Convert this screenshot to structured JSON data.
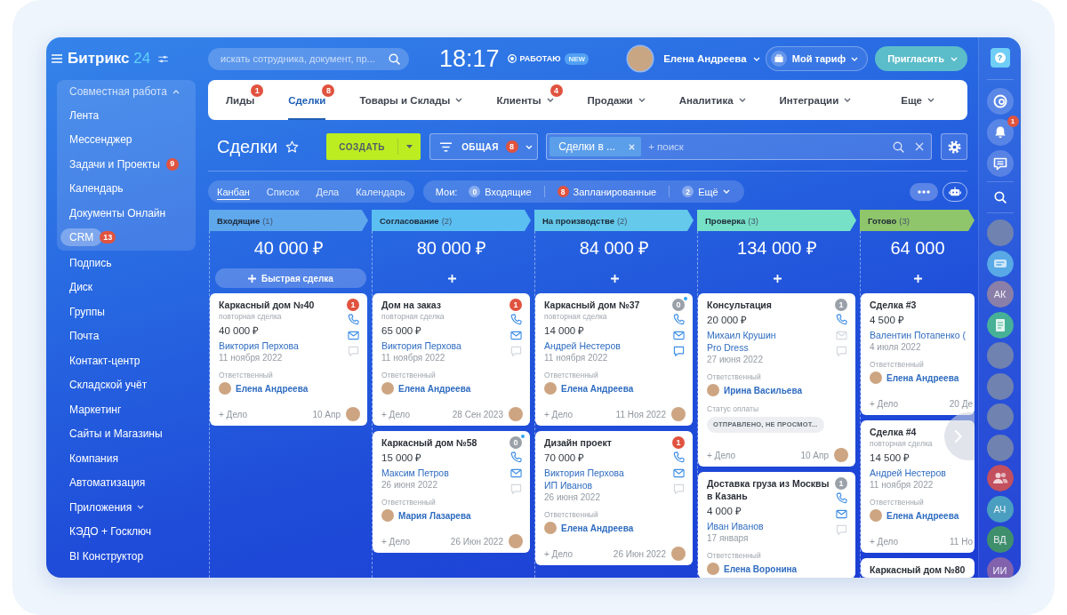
{
  "sidebar": {
    "logo": {
      "name": "Битрикс",
      "number": "24"
    },
    "items": [
      {
        "kind": "group",
        "label": "Совместная работа",
        "expanded": true,
        "children": [
          {
            "label": "Лента",
            "selected": false
          },
          {
            "label": "Мессенджер",
            "selected": false
          },
          {
            "label": "Задачи и Проекты",
            "selected": false,
            "badge": "9"
          },
          {
            "label": "Календарь",
            "selected": false
          },
          {
            "label": "Документы Онлайн",
            "selected": false
          },
          {
            "label": "CRM",
            "selected": true,
            "badge": "13"
          }
        ]
      },
      {
        "kind": "link",
        "label": "Подпись",
        "selected": false
      },
      {
        "kind": "link",
        "label": "Диск",
        "selected": false
      },
      {
        "kind": "link",
        "label": "Группы",
        "selected": false
      },
      {
        "kind": "link",
        "label": "Почта",
        "selected": false
      },
      {
        "kind": "link",
        "label": "Контакт-центр",
        "selected": false
      },
      {
        "kind": "link",
        "label": "Складской учёт",
        "selected": false
      },
      {
        "kind": "link",
        "label": "Маркетинг",
        "selected": false
      },
      {
        "kind": "link",
        "label": "Сайты и Магазины",
        "selected": false
      },
      {
        "kind": "link",
        "label": "Компания",
        "selected": false
      },
      {
        "kind": "link",
        "label": "Автоматизация",
        "selected": false
      },
      {
        "kind": "group",
        "label": "Приложения",
        "expanded": false
      },
      {
        "kind": "link",
        "label": "КЭДО + Госключ",
        "selected": false
      },
      {
        "kind": "link",
        "label": "BI Конструктор",
        "selected": false
      }
    ]
  },
  "header": {
    "search": {
      "placeholder": "искать сотрудника, документ, пр..."
    },
    "clock": "18:17",
    "work_status": {
      "label": "РАБОТАЮ",
      "badge": "NEW"
    },
    "user": {
      "name": "Елена Андреева"
    },
    "tariff_button": {
      "label": "Мой тариф"
    },
    "invite_button": {
      "label": "Пригласить"
    }
  },
  "nav_tabs": [
    {
      "label": "Лиды",
      "badge": "1",
      "dropdown": false,
      "selected": false
    },
    {
      "label": "Сделки",
      "badge": "8",
      "dropdown": false,
      "selected": true
    },
    {
      "label": "Товары и Склады",
      "dropdown": true,
      "selected": false
    },
    {
      "label": "Клиенты",
      "badge": "4",
      "dropdown": true,
      "selected": false
    },
    {
      "label": "Продажи",
      "dropdown": true,
      "selected": false
    },
    {
      "label": "Аналитика",
      "dropdown": true,
      "selected": false
    },
    {
      "label": "Интеграции",
      "dropdown": true,
      "selected": false
    },
    {
      "label": "Еще",
      "dropdown": true,
      "selected": false
    }
  ],
  "toolbar": {
    "title": "Сделки",
    "starred": false,
    "create_button": {
      "label": "СОЗДАТЬ"
    },
    "filter": {
      "label": "ОБЩАЯ",
      "badge": "8"
    },
    "search": {
      "chips": [
        {
          "label": "Сделки в ..."
        }
      ],
      "placeholder": "+ поиск"
    }
  },
  "view_bar": {
    "tabs": [
      {
        "label": "Канбан",
        "selected": true
      },
      {
        "label": "Список",
        "selected": false
      },
      {
        "label": "Дела",
        "selected": false
      },
      {
        "label": "Календарь",
        "selected": false
      }
    ],
    "counters": {
      "label": "Мои:",
      "items": [
        {
          "count": "0",
          "label": "Входящие",
          "alert": false,
          "dropdown": false
        },
        {
          "count": "8",
          "label": "Запланированные",
          "alert": true,
          "dropdown": false
        },
        {
          "count": "2",
          "label": "Ещё",
          "alert": false,
          "dropdown": true
        }
      ]
    }
  },
  "kanban": {
    "columns": [
      {
        "title": "Входящие",
        "count": "(1)",
        "color": "#5fa8ec",
        "total": "40 000 ₽",
        "quick_add": "Быстрая сделка",
        "cards": [
          {
            "title": "Каркасный дом №40",
            "counter": {
              "label": "1",
              "active": true,
              "dot": false
            },
            "subtitle": "повторная сделка",
            "amount": "40 000 ₽",
            "clients": [
              "Виктория Перхова"
            ],
            "date": "11 ноября 2022",
            "responsible": {
              "label": "Ответственный",
              "name": "Елена Андреева"
            },
            "contacts": {
              "phone": true,
              "email": true,
              "chat": false
            },
            "footer": {
              "action": "+ Дело",
              "date": "10 Апр",
              "avatar": true
            }
          }
        ]
      },
      {
        "title": "Согласование",
        "count": "(2)",
        "color": "#5bbff2",
        "total": "80 000 ₽",
        "cards": [
          {
            "title": "Дом на заказ",
            "counter": {
              "label": "1",
              "active": true,
              "dot": false
            },
            "subtitle": "повторная сделка",
            "amount": "65 000 ₽",
            "clients": [
              "Виктория Перхова"
            ],
            "date": "11 ноября 2022",
            "responsible": {
              "label": "Ответственный",
              "name": "Елена Андреева"
            },
            "contacts": {
              "phone": true,
              "email": true,
              "chat": false
            },
            "footer": {
              "action": "+ Дело",
              "date": "28 Сен 2023",
              "avatar": true
            }
          },
          {
            "title": "Каркасный дом №58",
            "counter": {
              "label": "0",
              "active": false,
              "dot": true
            },
            "amount": "15 000 ₽",
            "clients": [
              "Максим Петров"
            ],
            "date": "26 июня 2022",
            "responsible": {
              "label": "Ответственный",
              "name": "Мария Лазарева"
            },
            "contacts": {
              "phone": true,
              "email": true,
              "chat": false
            },
            "footer": {
              "action": "+ Дело",
              "date": "26 Июн 2022",
              "avatar": true
            }
          }
        ]
      },
      {
        "title": "На производстве",
        "count": "(2)",
        "color": "#64c9ea",
        "total": "84 000 ₽",
        "cards": [
          {
            "title": "Каркасный дом №37",
            "counter": {
              "label": "0",
              "active": false,
              "dot": true
            },
            "subtitle": "повторная сделка",
            "amount": "14 000 ₽",
            "clients": [
              "Андрей Нестеров"
            ],
            "date": "11 ноября 2022",
            "responsible": {
              "label": "Ответственный",
              "name": "Елена Андреева"
            },
            "contacts": {
              "phone": true,
              "email": true,
              "chat": true
            },
            "footer": {
              "action": "+ Дело",
              "date": "11 Ноя 2022",
              "avatar": true
            }
          },
          {
            "title": "Дизайн проект",
            "counter": {
              "label": "1",
              "active": true,
              "dot": false
            },
            "amount": "70 000 ₽",
            "clients": [
              "Виктория Перхова",
              "ИП Иванов"
            ],
            "date": "26 июня 2022",
            "responsible": {
              "label": "Ответственный",
              "name": "Елена Андреева"
            },
            "contacts": {
              "phone": true,
              "email": true,
              "chat": false
            },
            "footer": {
              "action": "+ Дело",
              "date": "26 Июн 2022",
              "avatar": true
            }
          }
        ]
      },
      {
        "title": "Проверка",
        "count": "(3)",
        "color": "#76e1c7",
        "total": "134 000 ₽",
        "cards": [
          {
            "title": "Консультация",
            "counter": {
              "label": "1",
              "active": false,
              "dot": false
            },
            "amount": "20 000 ₽",
            "clients": [
              "Михаил Крушин",
              "Pro Dress"
            ],
            "date": "27 июня 2022",
            "responsible": {
              "label": "Ответственный",
              "name": "Ирина Васильева"
            },
            "payment": {
              "label": "Статус оплаты",
              "status": "ОТПРАВЛЕНО, НЕ ПРОСМОТ..."
            },
            "contacts": {
              "phone": true,
              "email": false,
              "chat": false
            },
            "footer": {
              "action": "+ Дело",
              "date": "10 Апр",
              "avatar": true
            }
          },
          {
            "title": "Доставка груза из Москвы в Казань",
            "counter": {
              "label": "1",
              "active": false,
              "dot": false
            },
            "amount": "4 000 ₽",
            "clients": [
              "Иван Иванов"
            ],
            "date": "17 января",
            "responsible": {
              "label": "Ответственный",
              "name": "Елена Воронина"
            },
            "contacts": {
              "phone": true,
              "email": true,
              "chat": false
            }
          }
        ]
      },
      {
        "title": "Готово",
        "count": "(3)",
        "color": "#8fc56b",
        "total": "64 000",
        "cards": [
          {
            "title": "Сделка #3",
            "amount": "4 500 ₽",
            "clients": [
              "Валентин Потапенко ("
            ],
            "date": "4 июля 2022",
            "responsible": {
              "label": "Ответственный",
              "name": "Елена Андреева"
            },
            "footer": {
              "action": "+ Дело",
              "date": "20 Де",
              "avatar": false
            }
          },
          {
            "title": "Сделка #4",
            "subtitle": "повторная сделка",
            "amount": "14 500 ₽",
            "clients": [
              "Андрей Нестеров"
            ],
            "date": "11 ноября 2022",
            "responsible": {
              "label": "Ответственный",
              "name": "Елена Андреева"
            },
            "footer": {
              "action": "+ Дело",
              "date": "11 Но",
              "avatar": false
            }
          },
          {
            "title": "Каркасный дом №80"
          }
        ]
      }
    ]
  },
  "right_rail": {
    "help": "?",
    "notifications_badge": "1",
    "contacts": [
      {
        "kind": "photo"
      },
      {
        "kind": "chat"
      },
      {
        "kind": "initials",
        "initials": "АК",
        "color": "#8a7fa8"
      },
      {
        "kind": "document"
      },
      {
        "kind": "photo"
      },
      {
        "kind": "photo"
      },
      {
        "kind": "photo"
      },
      {
        "kind": "photo"
      },
      {
        "kind": "group"
      },
      {
        "kind": "initials",
        "initials": "АЧ",
        "color": "#4a9fc0"
      },
      {
        "kind": "initials",
        "initials": "ВД",
        "color": "#3f8f6c"
      },
      {
        "kind": "initials",
        "initials": "ИИ",
        "color": "#8262ad"
      }
    ]
  }
}
